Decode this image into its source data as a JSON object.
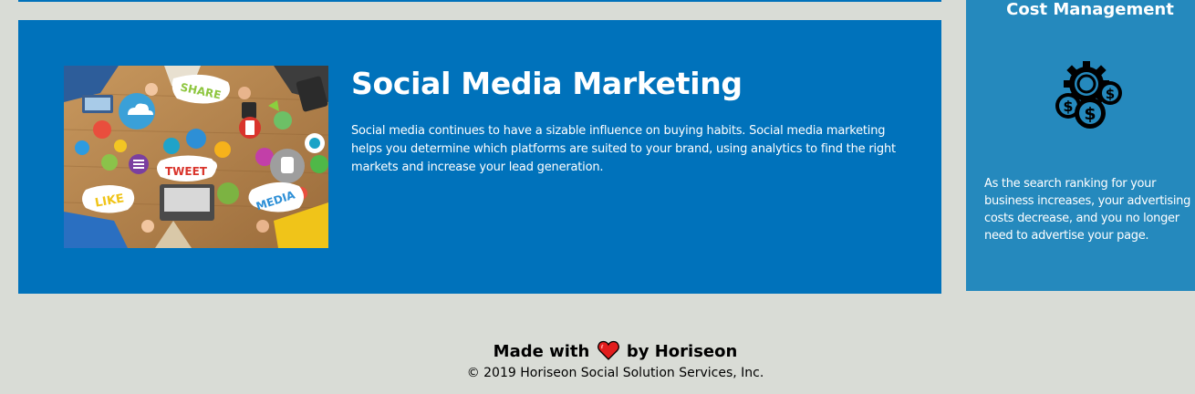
{
  "card": {
    "title": "Social Media Marketing",
    "description": "Social media continues to have a sizable influence on buying habits. Social media marketing helps you determine which platforms are suited to your brand, using analytics to find the right markets and increase your lead generation.",
    "image_badges": {
      "share": "SHARE",
      "tweet": "TWEET",
      "like": "LIKE",
      "media": "MEDIA"
    }
  },
  "aside": {
    "title": "Cost Management",
    "icon": "cost-management-icon",
    "text": "As the search ranking for your business increases, your advertising costs decrease, and you no longer need to advertise your page."
  },
  "footer": {
    "made_with": "Made with",
    "heart_icon": "heart-icon",
    "by": "by Horiseon",
    "copyright": "© 2019 Horiseon Social Solution Services, Inc."
  },
  "colors": {
    "page_background": "#d9dcd6",
    "card_background": "#0072bb",
    "aside_background": "#2589bd",
    "heart": "#e11d1d"
  }
}
